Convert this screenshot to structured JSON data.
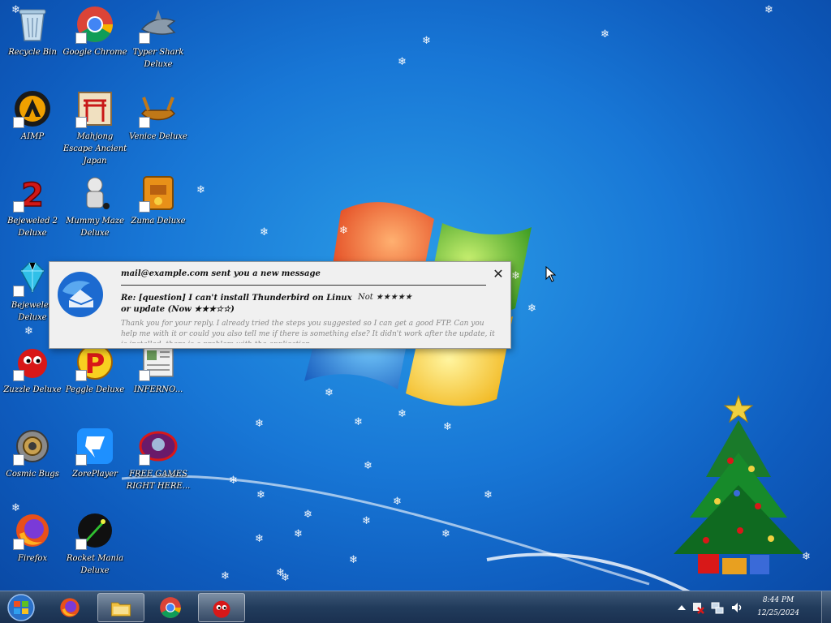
{
  "desktop": {
    "icons": [
      {
        "label": "Recycle Bin",
        "icon": "recycle-bin-icon"
      },
      {
        "label": "Google Chrome",
        "icon": "chrome-icon"
      },
      {
        "label": "Typer Shark Deluxe",
        "icon": "typer-shark-icon"
      },
      {
        "label": "AIMP",
        "icon": "aimp-icon"
      },
      {
        "label": "Mahjong Escape Ancient Japan",
        "icon": "mahjong-icon"
      },
      {
        "label": "Venice Deluxe",
        "icon": "venice-icon"
      },
      {
        "label": "Bejeweled 2 Deluxe",
        "icon": "bejeweled-2-icon"
      },
      {
        "label": "Mummy Maze Deluxe",
        "icon": "mummy-maze-icon"
      },
      {
        "label": "Zuma Deluxe",
        "icon": "zuma-icon"
      },
      {
        "label": "Bejeweled Deluxe",
        "icon": "bejeweled-icon"
      },
      {
        "label": "Zuzzle Deluxe",
        "icon": "zuzzle-icon"
      },
      {
        "label": "Peggle Deluxe",
        "icon": "peggle-icon"
      },
      {
        "label": "INFERNO...",
        "icon": "document-icon"
      },
      {
        "label": "Cosmic Bugs",
        "icon": "cosmic-bugs-icon"
      },
      {
        "label": "ZorePlayer",
        "icon": "zoreplayer-icon"
      },
      {
        "label": "FREE GAMES RIGHT HERE...",
        "icon": "free-games-icon"
      },
      {
        "label": "Firefox",
        "icon": "firefox-icon"
      },
      {
        "label": "Rocket Mania Deluxe",
        "icon": "rocket-mania-icon"
      }
    ]
  },
  "notification": {
    "sender": "mail@example.com sent you a new message",
    "close_symbol": "✕",
    "subject": "Re: [question] I can't install Thunderbird on Linux or update (Now ★★★☆☆)",
    "meta": "Not ★★★★★",
    "preview": "Thank you for your reply. I already tried the steps you suggested so I can get a good FTP. Can you help me with it or could you also tell me if there is something else? It didn't work after the update, it is installed, there is a problem with the application."
  },
  "taskbar": {
    "start_label": "Start",
    "pinned": [
      {
        "name": "firefox",
        "icon": "firefox-icon",
        "active": false
      },
      {
        "name": "file-explorer",
        "icon": "folder-icon",
        "active": true
      },
      {
        "name": "chrome",
        "icon": "chrome-icon",
        "active": false
      },
      {
        "name": "zuzzle",
        "icon": "zuzzle-icon",
        "active": true
      }
    ],
    "tray": {
      "icons": [
        "show-hidden-icons-icon",
        "action-center-flag-icon",
        "network-icon",
        "volume-icon"
      ],
      "time": "8:44 PM",
      "date": "12/25/2024"
    }
  },
  "colors": {
    "desktop_bg": "#1877d6",
    "taskbar": "#223c5c",
    "notification_bg": "#f0f0f0",
    "icon_label": "#ffffff"
  }
}
